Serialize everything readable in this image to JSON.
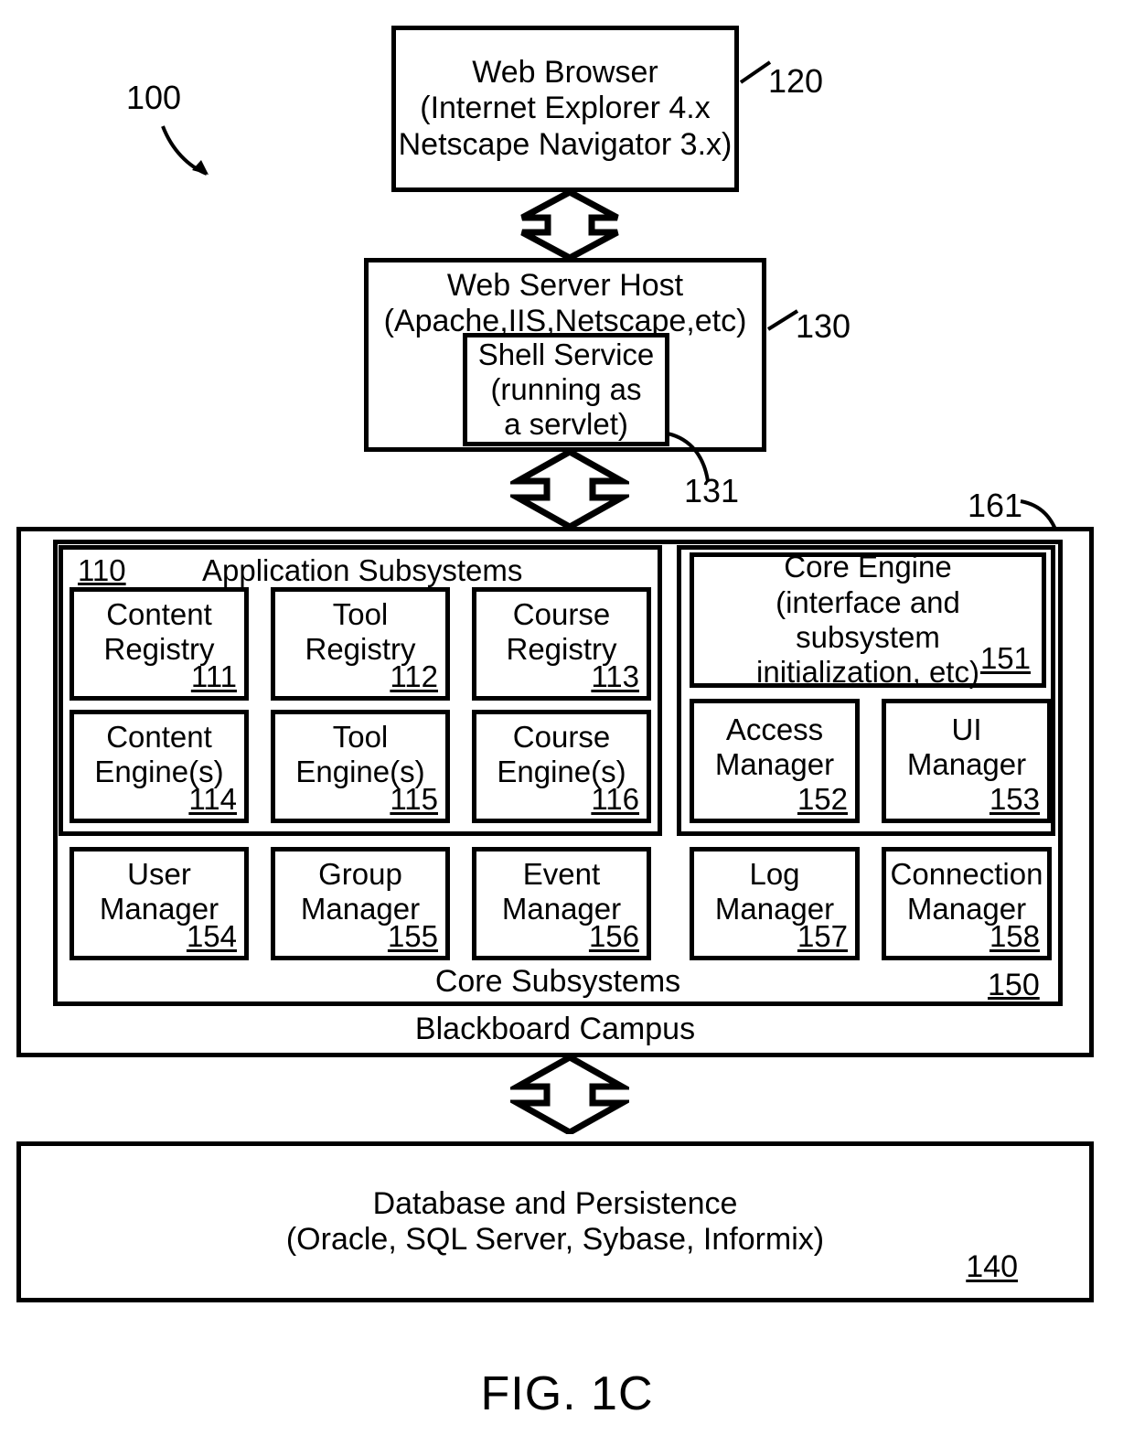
{
  "figure": {
    "caption": "FIG. 1C",
    "system_ref": "100",
    "outer_ref": "161"
  },
  "nodes": {
    "browser": {
      "ref": "120",
      "lines": "Web Browser\n(Internet Explorer 4.x\nNetscape Navigator 3.x)"
    },
    "web_server": {
      "ref": "130",
      "lines": "Web Server Host\n(Apache,IIS,Netscape,etc)"
    },
    "shell_service": {
      "ref": "131",
      "lines": "Shell Service\n(running as\na servlet)"
    },
    "blackboard_campus": {
      "label": "Blackboard Campus"
    },
    "core_subsystems": {
      "label": "Core Subsystems",
      "ref": "150"
    },
    "application_subsystems": {
      "label": "Application Subsystems",
      "ref": "110"
    },
    "database": {
      "ref": "140",
      "lines": "Database and Persistence\n(Oracle, SQL Server, Sybase, Informix)"
    }
  },
  "application_boxes": [
    {
      "label": "Content\nRegistry",
      "ref": "111"
    },
    {
      "label": "Tool\nRegistry",
      "ref": "112"
    },
    {
      "label": "Course\nRegistry",
      "ref": "113"
    },
    {
      "label": "Content\nEngine(s)",
      "ref": "114"
    },
    {
      "label": "Tool\nEngine(s)",
      "ref": "115"
    },
    {
      "label": "Course\nEngine(s)",
      "ref": "116"
    }
  ],
  "core_engine": {
    "label": "Core Engine\n(interface and\nsubsystem\ninitialization, etc)",
    "ref": "151"
  },
  "core_boxes": [
    {
      "label": "Access\nManager",
      "ref": "152"
    },
    {
      "label": "UI\nManager",
      "ref": "153"
    },
    {
      "label": "User\nManager",
      "ref": "154"
    },
    {
      "label": "Group\nManager",
      "ref": "155"
    },
    {
      "label": "Event\nManager",
      "ref": "156"
    },
    {
      "label": "Log\nManager",
      "ref": "157"
    },
    {
      "label": "Connection\nManager",
      "ref": "158"
    }
  ],
  "colors": {
    "stroke": "#000000",
    "background": "#ffffff"
  }
}
